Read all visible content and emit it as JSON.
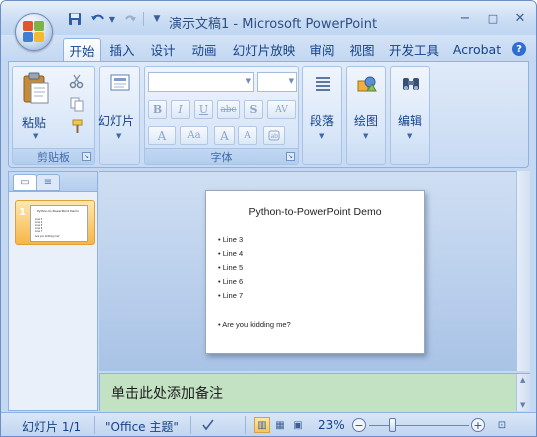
{
  "window": {
    "title": "演示文稿1 - Microsoft PowerPoint",
    "controls": {
      "minimize": "−",
      "maximize": "□",
      "close": "✕"
    }
  },
  "quick_access": {
    "save_icon": "save-icon",
    "undo_icon": "undo-icon",
    "redo_icon": "redo-icon"
  },
  "tabs": [
    {
      "label": "开始",
      "active": true
    },
    {
      "label": "插入",
      "active": false
    },
    {
      "label": "设计",
      "active": false
    },
    {
      "label": "动画",
      "active": false
    },
    {
      "label": "幻灯片放映",
      "active": false
    },
    {
      "label": "审阅",
      "active": false
    },
    {
      "label": "视图",
      "active": false
    },
    {
      "label": "开发工具",
      "active": false
    },
    {
      "label": "Acrobat",
      "active": false
    }
  ],
  "ribbon": {
    "clipboard": {
      "paste_label": "粘贴",
      "group_label": "剪贴板"
    },
    "slides": {
      "slide_label": "幻灯片"
    },
    "font": {
      "group_label": "字体",
      "font_name": "",
      "font_size": "",
      "bold": "B",
      "italic": "I",
      "underline": "U",
      "strike": "abc",
      "shadow": "S",
      "spacing": "AV",
      "case": "Aa",
      "color": "A",
      "grow": "A",
      "shrink": "A"
    },
    "paragraph": {
      "label": "段落"
    },
    "drawing": {
      "label": "绘图"
    },
    "editing": {
      "label": "编辑"
    }
  },
  "slide_pane": {
    "slide_number": "1"
  },
  "slide": {
    "title": "Python-to-PowerPoint Demo",
    "bullets": [
      "Line 3",
      "Line 4",
      "Line 5",
      "Line 6",
      "Line 7",
      "",
      "Are you kidding me?"
    ]
  },
  "notes": {
    "placeholder": "单击此处添加备注"
  },
  "status": {
    "slide_counter": "幻灯片 1/1",
    "theme": "\"Office 主题\"",
    "zoom": "23%",
    "zoom_fraction": 0.23
  },
  "colors": {
    "accent": "#15428b",
    "ribbon_bg": "#dfeaf8",
    "notes_bg": "#c3e1c3",
    "thumb_selected": "#f7b646"
  }
}
